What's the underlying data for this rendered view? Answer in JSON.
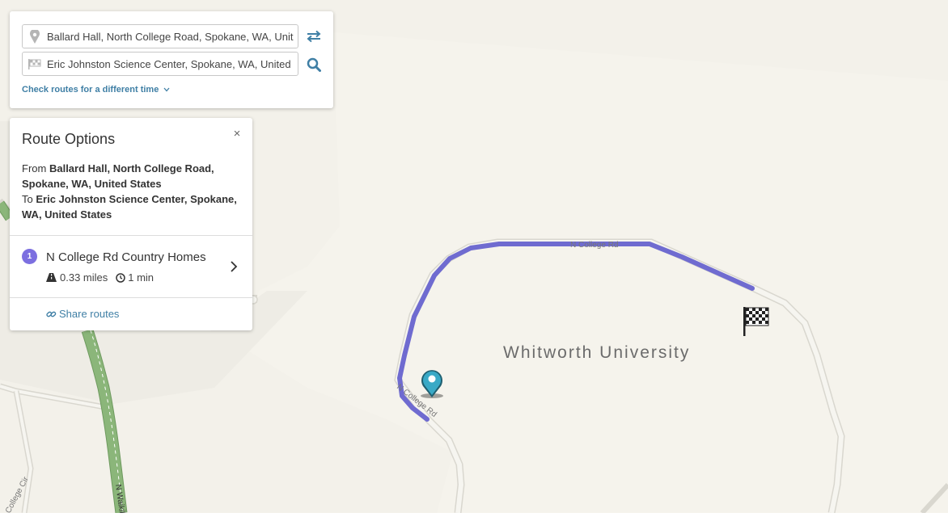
{
  "search": {
    "from_value": "Ballard Hall, North College Road, Spokane, WA, United States",
    "to_value": "Eric Johnston Science Center, Spokane, WA, United States",
    "time_link": "Check routes for a different time",
    "icons": {
      "from": "map-pin-icon",
      "to": "flag-icon",
      "swap": "swap-arrows-icon",
      "search": "search-icon",
      "time_caret": "chevron-down-icon"
    }
  },
  "route_panel": {
    "title": "Route Options",
    "close": "×",
    "from_prefix": "From",
    "from_place": "Ballard Hall, North College Road, Spokane, WA, United States",
    "to_prefix": "To",
    "to_place": "Eric Johnston Science Center, Spokane, WA, United States",
    "routes": [
      {
        "number": "1",
        "name": "N College Rd Country Homes",
        "distance": "0.33 miles",
        "duration": "1 min"
      }
    ],
    "share_label": "Share routes"
  },
  "map": {
    "place_label": "Whitworth University",
    "road_labels": {
      "college_rd_top": "N College Rd",
      "college_rd_left": "N College Rd",
      "waikiki": "N Waikiki",
      "college_cir": "College Cir"
    },
    "colors": {
      "background": "#f3f1ea",
      "route": "#6f6bd0",
      "highway": "#8bb67a",
      "road_casing": "#d9d7cf",
      "road_fill": "#f6f5f0",
      "start_marker": "#39a9c6"
    },
    "markers": {
      "start": "start-marker-icon",
      "end": "checkered-flag-icon"
    }
  }
}
